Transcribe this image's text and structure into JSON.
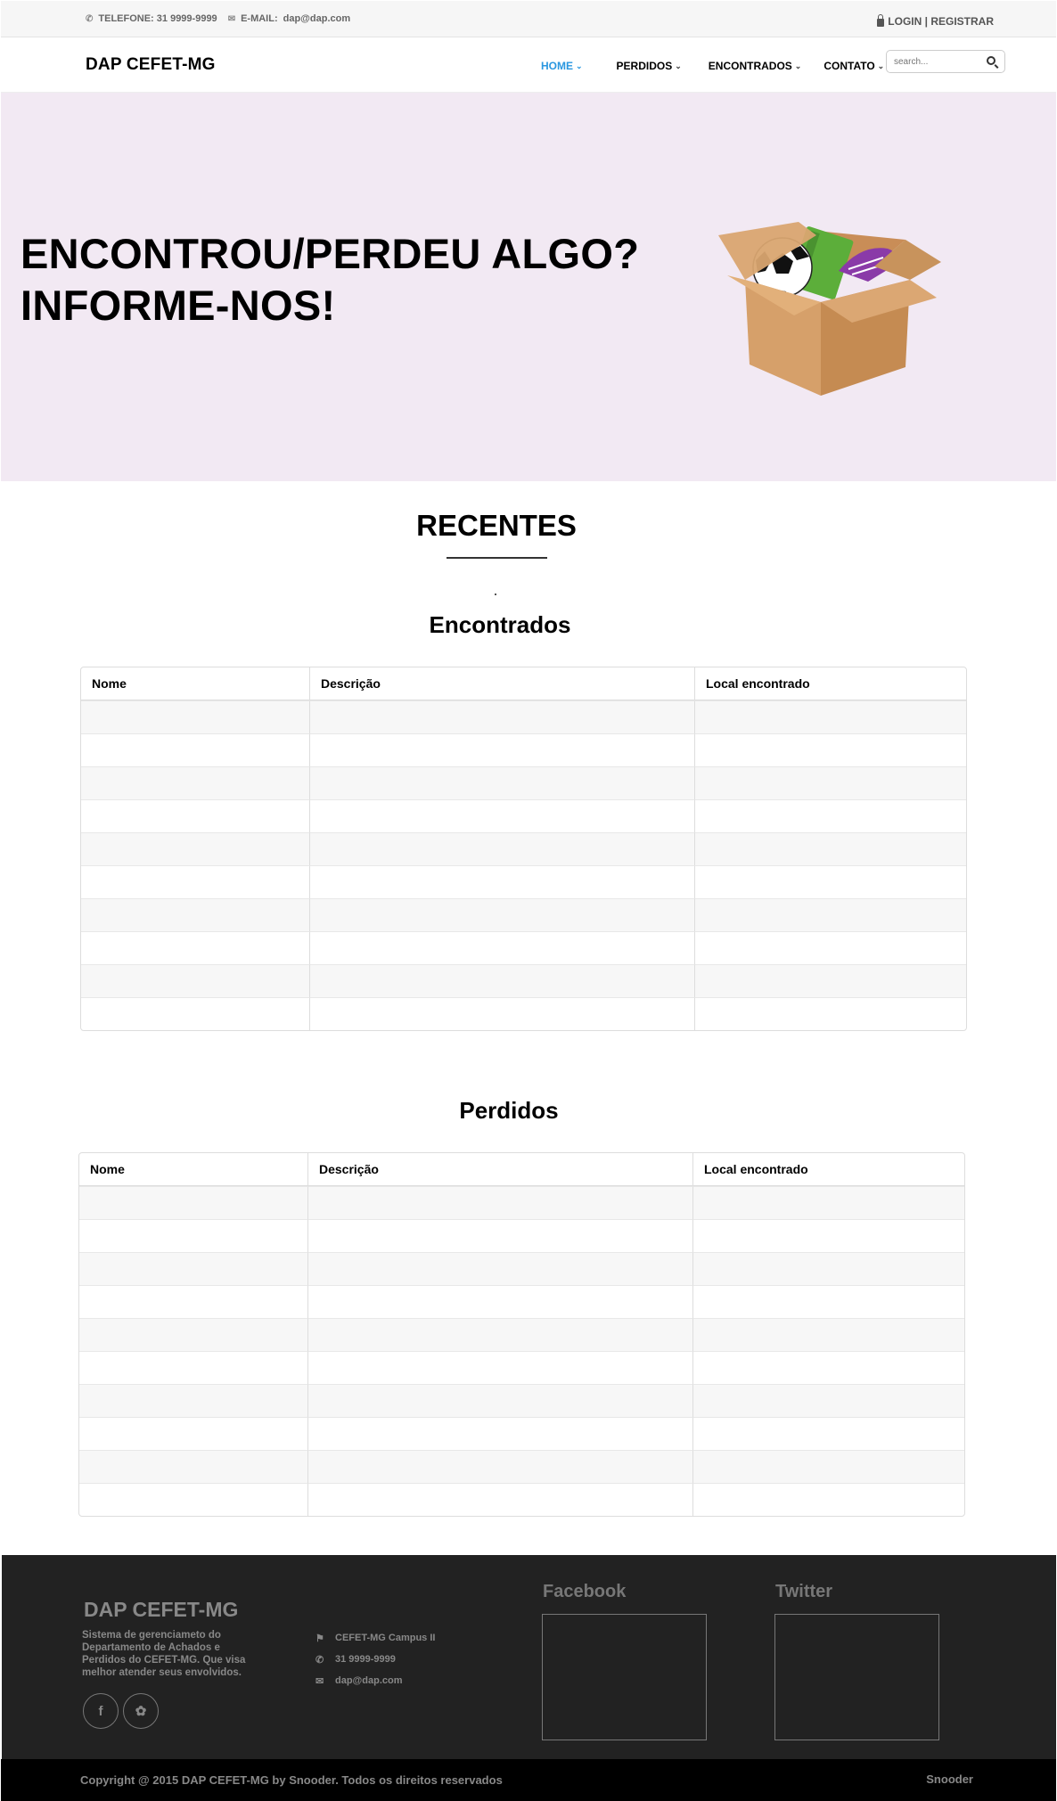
{
  "topbar": {
    "phone": "TELEFONE: 31 9999-9999",
    "email_label": "E-MAIL:",
    "email_value": "dap@dap.com",
    "auth": "LOGIN | REGISTRAR"
  },
  "nav": {
    "brand": "DAP CEFET-MG",
    "items": [
      {
        "label": "HOME",
        "active": true
      },
      {
        "label": "PERDIDOS",
        "active": false
      },
      {
        "label": "ENCONTRADOS",
        "active": false
      },
      {
        "label": "CONTATO",
        "active": false
      }
    ],
    "search_placeholder": "search..."
  },
  "hero": {
    "line1": "ENCONTROU/PERDEU ALGO?",
    "line2": "INFORME-NOS!"
  },
  "recentes": {
    "title": "RECENTES",
    "encontrados": {
      "title": "Encontrados",
      "columns": [
        "Nome",
        "Descrição",
        "Local encontrado"
      ],
      "rows": [
        [
          "",
          "",
          ""
        ],
        [
          "",
          "",
          ""
        ],
        [
          "",
          "",
          ""
        ],
        [
          "",
          "",
          ""
        ],
        [
          "",
          "",
          ""
        ],
        [
          "",
          "",
          ""
        ],
        [
          "",
          "",
          ""
        ],
        [
          "",
          "",
          ""
        ],
        [
          "",
          "",
          ""
        ],
        [
          "",
          "",
          ""
        ]
      ]
    },
    "perdidos": {
      "title": "Perdidos",
      "columns": [
        "Nome",
        "Descrição",
        "Local encontrado"
      ],
      "rows": [
        [
          "",
          "",
          ""
        ],
        [
          "",
          "",
          ""
        ],
        [
          "",
          "",
          ""
        ],
        [
          "",
          "",
          ""
        ],
        [
          "",
          "",
          ""
        ],
        [
          "",
          "",
          ""
        ],
        [
          "",
          "",
          ""
        ],
        [
          "",
          "",
          ""
        ],
        [
          "",
          "",
          ""
        ],
        [
          "",
          "",
          ""
        ]
      ]
    }
  },
  "footer": {
    "brand": "DAP CEFET-MG",
    "description": "Sistema de gerenciameto do Departamento de Achados e Perdidos do CEFET-MG. Que visa melhor atender seus envolvidos.",
    "address": "CEFET-MG Campus II",
    "phone": "31 9999-9999",
    "email": "dap@dap.com",
    "facebook_title": "Facebook",
    "twitter_title": "Twitter",
    "copyright": "Copyright @ 2015 DAP CEFET-MG by Snooder. Todos os direitos reservados",
    "credit": "Snooder"
  }
}
